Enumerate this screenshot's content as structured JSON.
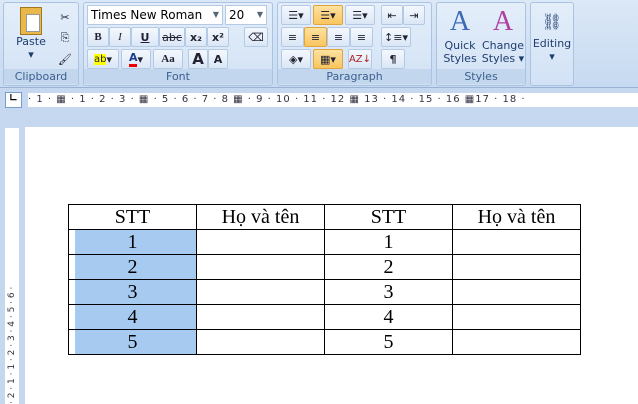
{
  "ribbon": {
    "clipboard": {
      "label": "Clipboard",
      "paste": "Paste"
    },
    "font": {
      "label": "Font",
      "name": "Times New Roman",
      "size": "20",
      "bold": "B",
      "italic": "I",
      "underline": "U",
      "strike": "abc",
      "subscript": "x₂",
      "superscript": "x²",
      "case": "Aa",
      "grow": "A",
      "shrink": "A",
      "color_letter": "A"
    },
    "paragraph": {
      "label": "Paragraph",
      "pilcrow": "¶"
    },
    "styles": {
      "label": "Styles",
      "quick": "Quick Styles ▾",
      "change": "Change Styles ▾"
    },
    "editing": {
      "label": "Editing"
    }
  },
  "ruler": {
    "text": "· 1 · ▦ · 1 · 2 · 3 · ▦ · 5 · 6 · 7 · 8 ▦ · 9 · 10 · 11 · 12 ▦ 13 · 14 · 15 · 16 ▦17 · 18 ·",
    "vertical": "· 2 · 1 · 1 · 2 · 3 · 4 · 5 · 6 ·"
  },
  "table": {
    "headers": [
      "STT",
      "Họ và tên",
      "STT",
      "Họ và tên"
    ],
    "rows": [
      [
        "1",
        "",
        "1",
        ""
      ],
      [
        "2",
        "",
        "2",
        ""
      ],
      [
        "3",
        "",
        "3",
        ""
      ],
      [
        "4",
        "",
        "4",
        ""
      ],
      [
        "5",
        "",
        "5",
        ""
      ]
    ]
  },
  "colors": {
    "selection": "#a7cbf0",
    "ribbon": "#d2e2f5"
  }
}
